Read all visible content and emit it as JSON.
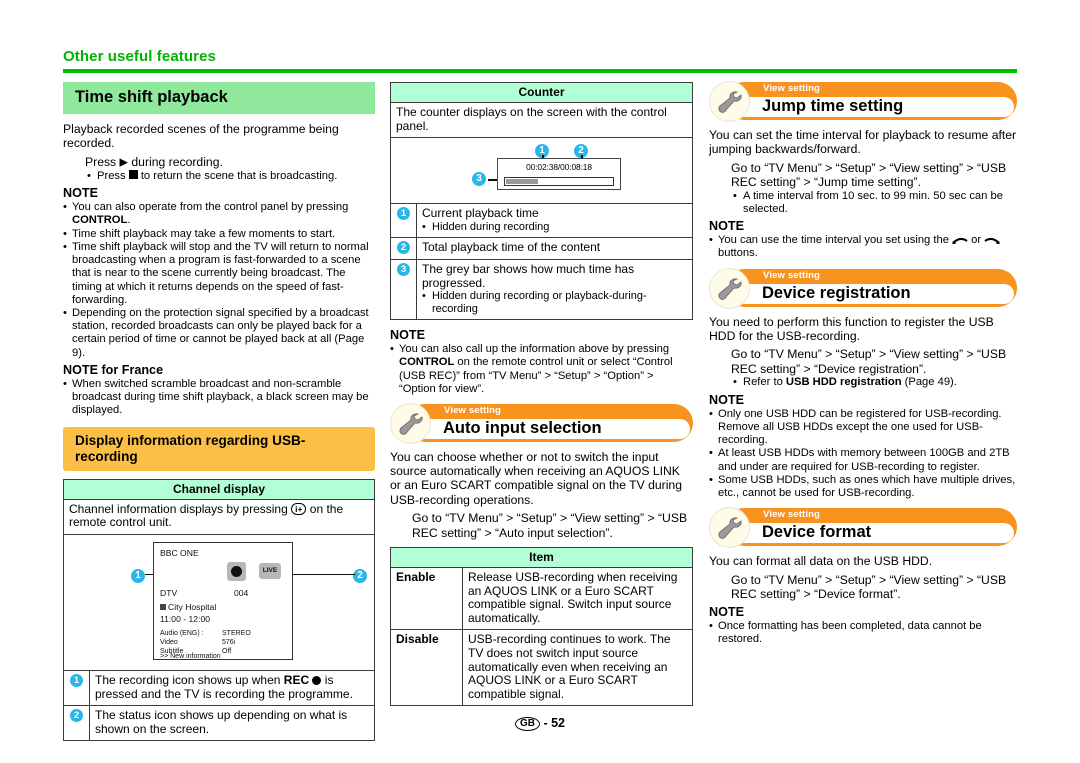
{
  "running_head": "Other useful features",
  "footer": {
    "region": "GB",
    "separator": "-",
    "page": "52"
  },
  "colors": {
    "accent_green": "#00c000",
    "section_green": "#8fe89b",
    "table_header_green": "#b2ffd6",
    "section_orange": "#fbbf45",
    "banner_orange": "#f7931e",
    "callout_cyan": "#29b6e8"
  },
  "left_column": {
    "section_title": "Time shift playback",
    "intro": "Playback recorded scenes of the programme being recorded.",
    "step": "Press ▶ during recording.",
    "step_sub": "Press ■ to return the scene that is broadcasting.",
    "note_label": "NOTE",
    "notes": [
      "You can also operate from the control panel by pressing CONTROL.",
      "Time shift playback may take a few moments to start.",
      "Time shift playback will stop and the TV will return to normal broadcasting when a program is fast-forwarded to a scene that is near to the scene currently being broadcast. The timing at which it returns depends on the speed of fast-forwarding.",
      "Depending on the protection signal specified by a broadcast station, recorded broadcasts can only be played back for a certain period of time or cannot be played back at all (Page 9)."
    ],
    "note_france_label": "NOTE for France",
    "notes_france": [
      "When switched scramble broadcast and non-scramble broadcast during time shift playback, a black screen may be displayed."
    ],
    "orange_title": "Display information regarding USB-recording",
    "channel_table": {
      "header": "Channel display",
      "description": "Channel information displays by pressing ⓘ+ on the remote control unit.",
      "tv_mock": {
        "channel_name": "BBC ONE",
        "live_label": "LIVE",
        "source": "DTV",
        "channel_number": "004",
        "programme": "City Hospital",
        "time": "11:00 - 12:00",
        "rows": [
          {
            "label": "Audio (ENG)  :",
            "value": "STEREO"
          },
          {
            "label": "Video",
            "value": "576i"
          },
          {
            "label": "Subtitle",
            "value": "Off"
          }
        ],
        "more": ">> New information",
        "callout_1": "1",
        "callout_2": "2"
      },
      "legend": [
        {
          "num": "1",
          "text": "The recording icon shows up when REC ● is pressed and the TV is recording the programme."
        },
        {
          "num": "2",
          "text": "The status icon shows up depending on what is shown on the screen."
        }
      ]
    }
  },
  "middle_column": {
    "counter_table": {
      "header": "Counter",
      "description": "The counter displays on the screen with the control panel.",
      "counter_mock": {
        "time_display": "00:02:38/00:08:18",
        "callout_1": "1",
        "callout_2": "2",
        "callout_3": "3"
      },
      "legend": [
        {
          "num": "1",
          "text": "Current playback time",
          "sub": "Hidden during recording"
        },
        {
          "num": "2",
          "text": "Total playback time of the content",
          "sub": ""
        },
        {
          "num": "3",
          "text": "The grey bar shows how much time has progressed.",
          "sub": "Hidden during recording or playback-during-recording"
        }
      ]
    },
    "note_label": "NOTE",
    "notes": [
      "You can also call up the information above by pressing CONTROL on the remote control unit or select “Control (USB REC)” from “TV Menu” > “Setup” > “Option” > “Option for view”."
    ],
    "banner": {
      "sub": "View setting",
      "title": "Auto input selection",
      "icon": "wrench-icon"
    },
    "body": "You can choose whether or not to switch the input source automatically when receiving an AQUOS LINK or an Euro SCART compatible signal on the TV during USB-recording operations.",
    "path": "Go to “TV Menu” > “Setup” > “View setting” > “USB REC setting” > “Auto input selection”.",
    "item_table": {
      "header": "Item",
      "rows": [
        {
          "label": "Enable",
          "text": "Release USB-recording when receiving an AQUOS LINK or a Euro SCART compatible signal. Switch input source automatically."
        },
        {
          "label": "Disable",
          "text": "USB-recording continues to work. The TV does not switch input source automatically even when receiving an AQUOS LINK or a Euro SCART compatible signal."
        }
      ]
    }
  },
  "right_column": {
    "sections": [
      {
        "banner": {
          "sub": "View setting",
          "title": "Jump time setting",
          "icon": "wrench-icon"
        },
        "body": "You can set the time interval for playback to resume after jumping backwards/forward.",
        "path": "Go to “TV Menu” > “Setup” > “View setting” > “USB REC setting” > “Jump time setting”.",
        "path_sub": "A time interval from 10 sec. to 99 min. 50 sec can be selected.",
        "note_label": "NOTE",
        "notes": [
          "You can use the time interval you set using the ⌒ or ⌒ buttons."
        ]
      },
      {
        "banner": {
          "sub": "View setting",
          "title": "Device registration",
          "icon": "wrench-icon"
        },
        "body": "You need to perform this function to register the USB HDD for the USB-recording.",
        "path": "Go to “TV Menu” > “Setup” > “View setting” > “USB REC setting” > “Device registration”.",
        "path_sub": "Refer to USB HDD registration (Page 49).",
        "note_label": "NOTE",
        "notes": [
          "Only one USB HDD can be registered for USB-recording. Remove all USB HDDs except the one used for USB-recording.",
          "At least USB HDDs with memory between 100GB and 2TB and under are required for USB-recording to register.",
          "Some USB HDDs, such as ones which have multiple drives, etc., cannot be used for USB-recording."
        ]
      },
      {
        "banner": {
          "sub": "View setting",
          "title": "Device format",
          "icon": "wrench-icon"
        },
        "body": "You can format all data on the USB HDD.",
        "path": "Go to “TV Menu” > “Setup” > “View setting” > “USB REC setting” > “Device format”.",
        "path_sub": "",
        "note_label": "NOTE",
        "notes": [
          "Once formatting has been completed, data cannot be restored."
        ]
      }
    ]
  }
}
